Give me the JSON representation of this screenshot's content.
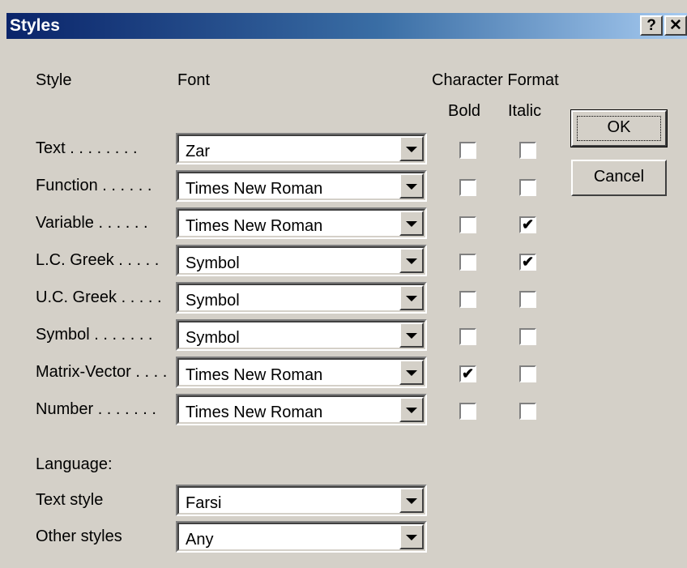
{
  "window": {
    "title": "Styles",
    "help_label": "?",
    "close_label": "✕"
  },
  "headers": {
    "style": "Style",
    "font": "Font",
    "character_format": "Character Format",
    "bold": "Bold",
    "italic": "Italic"
  },
  "styles": [
    {
      "label": "Text . . . . . . . .",
      "font": "Zar",
      "bold": false,
      "italic": false
    },
    {
      "label": "Function . . . . . .",
      "font": "Times New Roman",
      "bold": false,
      "italic": false
    },
    {
      "label": "Variable . . . . . .",
      "font": "Times New Roman",
      "bold": false,
      "italic": true
    },
    {
      "label": "L.C. Greek . . . . .",
      "font": "Symbol",
      "bold": false,
      "italic": true
    },
    {
      "label": "U.C. Greek . . . . .",
      "font": "Symbol",
      "bold": false,
      "italic": false
    },
    {
      "label": "Symbol . . . . . . .",
      "font": "Symbol",
      "bold": false,
      "italic": false
    },
    {
      "label": "Matrix-Vector . . . .",
      "font": "Times New Roman",
      "bold": true,
      "italic": false
    },
    {
      "label": "Number . . . . . . .",
      "font": "Times New Roman",
      "bold": false,
      "italic": false
    }
  ],
  "language": {
    "heading": "Language:",
    "text_style_label": "Text style",
    "text_style_value": "Farsi",
    "other_styles_label": "Other styles",
    "other_styles_value": "Any"
  },
  "buttons": {
    "ok": "OK",
    "cancel": "Cancel"
  },
  "check_glyph": "✔"
}
